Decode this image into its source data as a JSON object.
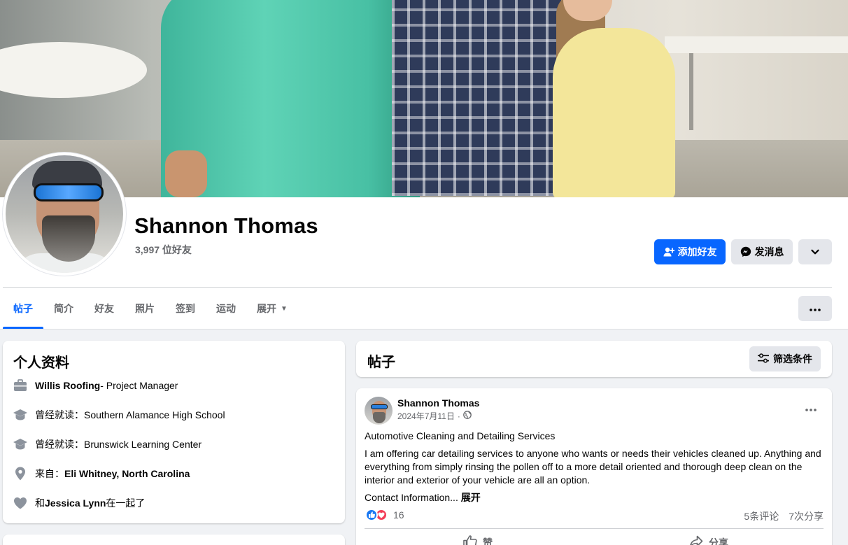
{
  "profile": {
    "name": "Shannon Thomas",
    "friends_count": "3,997 位好友"
  },
  "actions": {
    "add_friend": "添加好友",
    "message": "发消息"
  },
  "tabs": [
    {
      "label": "帖子"
    },
    {
      "label": "简介"
    },
    {
      "label": "好友"
    },
    {
      "label": "照片"
    },
    {
      "label": "签到"
    },
    {
      "label": "运动"
    },
    {
      "label": "展开"
    }
  ],
  "intro": {
    "title": "个人资料",
    "work": {
      "company": "Willis Roofing",
      "role": " - Project Manager"
    },
    "edu1": {
      "prefix": "曾经就读：",
      "school": "Southern Alamance High School"
    },
    "edu2": {
      "prefix": "曾经就读：",
      "school": "Brunswick Learning Center"
    },
    "from": {
      "prefix": "来自：",
      "place": "Eli Whitney, North Carolina"
    },
    "relationship": {
      "prefix": "和 ",
      "partner": "Jessica Lynn",
      "suffix": " 在一起了"
    }
  },
  "posts": {
    "title": "帖子",
    "filter_label": "筛选条件"
  },
  "post": {
    "author": "Shannon Thomas",
    "date": "2024年7月11日",
    "dot": "·",
    "line1": "Automotive Cleaning and Detailing Services",
    "body": "I am offering car detailing services to anyone who wants or needs their vehicles cleaned up. Anything and everything from simply rinsing the pollen off to a more detail oriented and thorough deep clean on the interior and exterior of your vehicle are all an option.",
    "contact": "Contact Information... ",
    "see_more": "展开",
    "reaction_count": "16",
    "comments": "5条评论",
    "shares": "7次分享",
    "like_label": "赞",
    "share_label": "分享"
  },
  "colors": {
    "primary": "#0866ff",
    "secondary_text": "#65676b",
    "button_gray": "#e4e6eb",
    "like_blue": "#1877f2",
    "love_red": "#f33e58"
  }
}
